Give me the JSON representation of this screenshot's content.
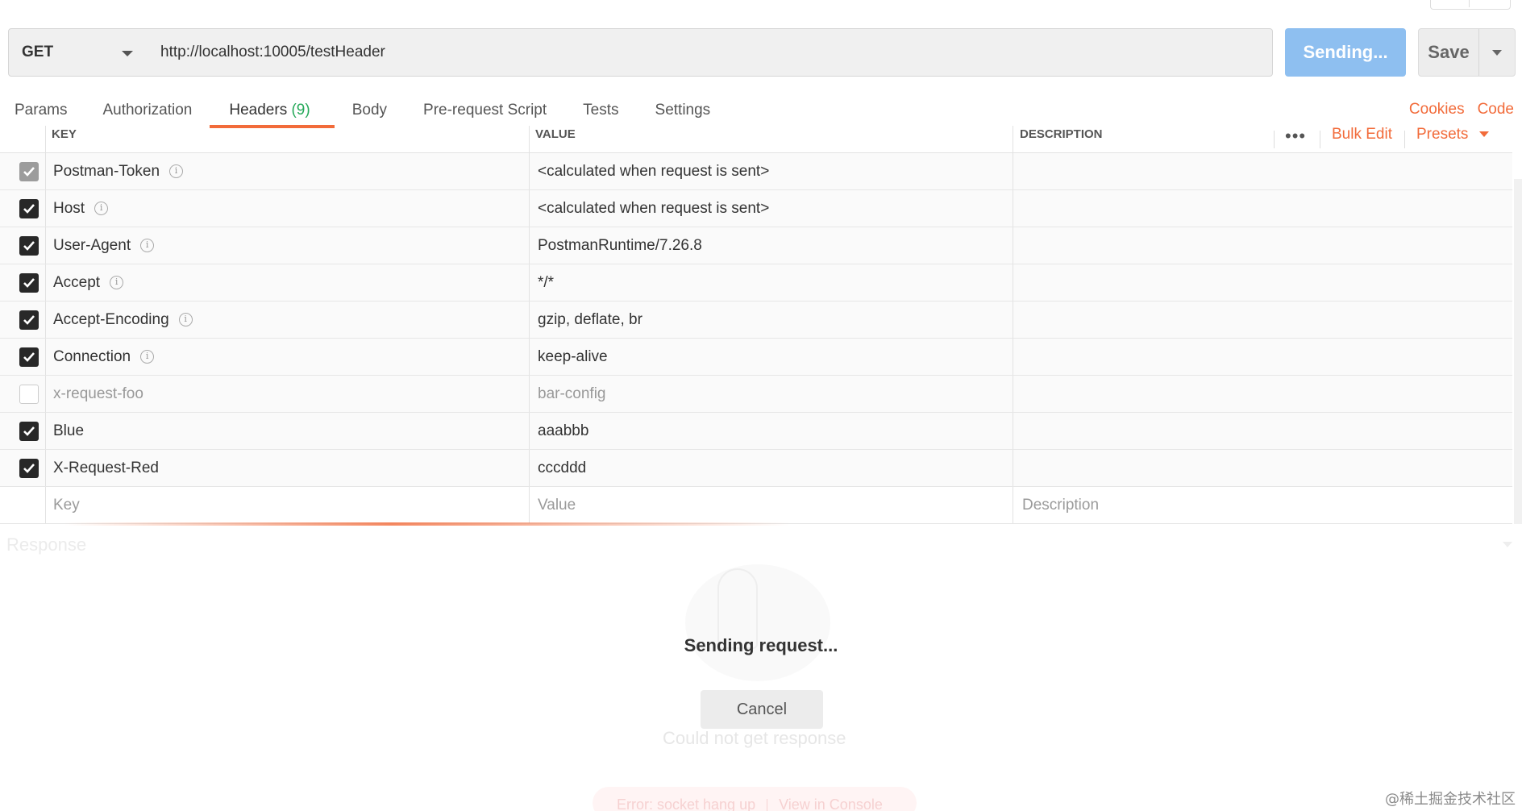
{
  "request": {
    "method": "GET",
    "url": "http://localhost:10005/testHeader",
    "send_label": "Sending...",
    "save_label": "Save"
  },
  "tabs": [
    {
      "label": "Params"
    },
    {
      "label": "Authorization"
    },
    {
      "label": "Headers",
      "count": "(9)"
    },
    {
      "label": "Body"
    },
    {
      "label": "Pre-request Script"
    },
    {
      "label": "Tests"
    },
    {
      "label": "Settings"
    }
  ],
  "links": {
    "cookies": "Cookies",
    "code": "Code"
  },
  "table": {
    "headers": {
      "key": "KEY",
      "value": "VALUE",
      "description": "DESCRIPTION"
    },
    "bulk_edit": "Bulk Edit",
    "presets": "Presets",
    "more": "•••",
    "rows": [
      {
        "key": "Postman-Token",
        "value": "<calculated when request is sent>",
        "checked": true
      },
      {
        "key": "Host",
        "value": "<calculated when request is sent>",
        "checked": true
      },
      {
        "key": "User-Agent",
        "value": "PostmanRuntime/7.26.8",
        "checked": true
      },
      {
        "key": "Accept",
        "value": "*/*",
        "checked": true
      },
      {
        "key": "Accept-Encoding",
        "value": "gzip, deflate, br",
        "checked": true
      },
      {
        "key": "Connection",
        "value": "keep-alive",
        "checked": true
      },
      {
        "key": "x-request-foo",
        "value": "bar-config",
        "checked": false
      },
      {
        "key": "Blue",
        "value": "aaabbb",
        "checked": true
      },
      {
        "key": "X-Request-Red",
        "value": "cccddd",
        "checked": true
      }
    ],
    "placeholder": {
      "key": "Key",
      "value": "Value",
      "description": "Description"
    }
  },
  "response": {
    "label": "Response",
    "status": "Sending request...",
    "cancel": "Cancel",
    "could_not": "Could not get response",
    "error": "Error: socket hang up",
    "view_console": "View in Console"
  },
  "watermark": "@稀土掘金技术社区",
  "colors": {
    "accent": "#f26b3a",
    "send": "#8ebff0",
    "count": "#26a95a"
  }
}
